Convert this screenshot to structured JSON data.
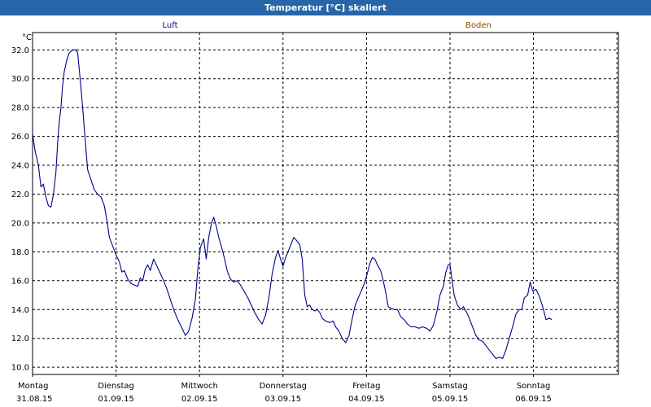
{
  "title": "Temperatur [°C] skaliert",
  "colors": {
    "titlebar": "#2565a8",
    "luft": "#00008b",
    "boden": "#8b4a00",
    "grid": "#000000"
  },
  "chart_data": {
    "type": "line",
    "title": "Temperatur [°C] skaliert",
    "ylabel": "°C",
    "ylim": [
      9.5,
      33.2
    ],
    "yticks": [
      "10.0",
      "12.0",
      "14.0",
      "16.0",
      "18.0",
      "20.0",
      "22.0",
      "24.0",
      "26.0",
      "28.0",
      "30.0",
      "32.0"
    ],
    "xlim": [
      0,
      7
    ],
    "xticks": [
      {
        "day": "Montag",
        "date": "31.08.15"
      },
      {
        "day": "Dienstag",
        "date": "01.09.15"
      },
      {
        "day": "Mittwoch",
        "date": "02.09.15"
      },
      {
        "day": "Donnerstag",
        "date": "03.09.15"
      },
      {
        "day": "Freitag",
        "date": "04.09.15"
      },
      {
        "day": "Samstag",
        "date": "05.09.15"
      },
      {
        "day": "Sonntag",
        "date": "06.09.15"
      }
    ],
    "grid": true,
    "legend_position": "top",
    "series": [
      {
        "name": "Luft",
        "color": "#00008b",
        "points": [
          [
            0.0,
            26.2
          ],
          [
            0.03,
            25.0
          ],
          [
            0.07,
            24.0
          ],
          [
            0.1,
            22.5
          ],
          [
            0.13,
            22.7
          ],
          [
            0.16,
            21.8
          ],
          [
            0.19,
            21.2
          ],
          [
            0.22,
            21.1
          ],
          [
            0.25,
            22.0
          ],
          [
            0.28,
            23.5
          ],
          [
            0.3,
            25.5
          ],
          [
            0.32,
            27.0
          ],
          [
            0.34,
            28.0
          ],
          [
            0.36,
            29.5
          ],
          [
            0.38,
            30.5
          ],
          [
            0.41,
            31.3
          ],
          [
            0.44,
            31.8
          ],
          [
            0.48,
            32.0
          ],
          [
            0.52,
            32.0
          ],
          [
            0.54,
            31.8
          ],
          [
            0.57,
            30.0
          ],
          [
            0.6,
            28.0
          ],
          [
            0.63,
            25.8
          ],
          [
            0.66,
            23.7
          ],
          [
            0.7,
            23.0
          ],
          [
            0.74,
            22.3
          ],
          [
            0.78,
            22.0
          ],
          [
            0.82,
            21.8
          ],
          [
            0.86,
            21.2
          ],
          [
            0.89,
            20.2
          ],
          [
            0.92,
            19.0
          ],
          [
            0.96,
            18.4
          ],
          [
            1.0,
            17.8
          ],
          [
            1.04,
            17.3
          ],
          [
            1.07,
            16.6
          ],
          [
            1.1,
            16.7
          ],
          [
            1.14,
            16.1
          ],
          [
            1.18,
            15.8
          ],
          [
            1.22,
            15.7
          ],
          [
            1.26,
            15.6
          ],
          [
            1.29,
            16.2
          ],
          [
            1.32,
            16.0
          ],
          [
            1.35,
            16.8
          ],
          [
            1.38,
            17.1
          ],
          [
            1.41,
            16.7
          ],
          [
            1.45,
            17.5
          ],
          [
            1.49,
            17.0
          ],
          [
            1.53,
            16.5
          ],
          [
            1.57,
            16.0
          ],
          [
            1.61,
            15.4
          ],
          [
            1.65,
            14.7
          ],
          [
            1.69,
            14.0
          ],
          [
            1.74,
            13.3
          ],
          [
            1.79,
            12.7
          ],
          [
            1.83,
            12.2
          ],
          [
            1.87,
            12.5
          ],
          [
            1.91,
            13.4
          ],
          [
            1.95,
            14.7
          ],
          [
            1.98,
            16.8
          ],
          [
            2.01,
            18.3
          ],
          [
            2.05,
            18.9
          ],
          [
            2.08,
            17.5
          ],
          [
            2.11,
            19.0
          ],
          [
            2.14,
            19.9
          ],
          [
            2.17,
            20.4
          ],
          [
            2.2,
            19.8
          ],
          [
            2.23,
            19.0
          ],
          [
            2.27,
            18.2
          ],
          [
            2.3,
            17.5
          ],
          [
            2.33,
            16.7
          ],
          [
            2.37,
            16.1
          ],
          [
            2.41,
            15.9
          ],
          [
            2.45,
            16.0
          ],
          [
            2.49,
            15.7
          ],
          [
            2.53,
            15.3
          ],
          [
            2.58,
            14.8
          ],
          [
            2.62,
            14.3
          ],
          [
            2.66,
            13.8
          ],
          [
            2.71,
            13.3
          ],
          [
            2.75,
            13.0
          ],
          [
            2.79,
            13.6
          ],
          [
            2.83,
            14.8
          ],
          [
            2.87,
            16.5
          ],
          [
            2.91,
            17.6
          ],
          [
            2.94,
            18.1
          ],
          [
            2.97,
            17.5
          ],
          [
            3.0,
            17.0
          ],
          [
            3.03,
            17.6
          ],
          [
            3.06,
            18.0
          ],
          [
            3.1,
            18.6
          ],
          [
            3.13,
            19.0
          ],
          [
            3.16,
            18.8
          ],
          [
            3.2,
            18.5
          ],
          [
            3.23,
            17.5
          ],
          [
            3.26,
            15.0
          ],
          [
            3.29,
            14.2
          ],
          [
            3.32,
            14.3
          ],
          [
            3.35,
            14.0
          ],
          [
            3.38,
            13.9
          ],
          [
            3.41,
            14.0
          ],
          [
            3.44,
            13.8
          ],
          [
            3.47,
            13.4
          ],
          [
            3.51,
            13.2
          ],
          [
            3.56,
            13.1
          ],
          [
            3.6,
            13.2
          ],
          [
            3.63,
            12.8
          ],
          [
            3.67,
            12.5
          ],
          [
            3.71,
            12.0
          ],
          [
            3.75,
            11.7
          ],
          [
            3.79,
            12.2
          ],
          [
            3.82,
            13.1
          ],
          [
            3.86,
            14.2
          ],
          [
            3.9,
            14.8
          ],
          [
            3.94,
            15.3
          ],
          [
            3.98,
            15.9
          ],
          [
            4.01,
            16.5
          ],
          [
            4.04,
            17.2
          ],
          [
            4.07,
            17.6
          ],
          [
            4.1,
            17.5
          ],
          [
            4.13,
            17.1
          ],
          [
            4.17,
            16.7
          ],
          [
            4.2,
            16.0
          ],
          [
            4.23,
            15.2
          ],
          [
            4.26,
            14.2
          ],
          [
            4.29,
            14.1
          ],
          [
            4.33,
            14.0
          ],
          [
            4.37,
            14.0
          ],
          [
            4.41,
            13.5
          ],
          [
            4.45,
            13.3
          ],
          [
            4.49,
            13.0
          ],
          [
            4.53,
            12.8
          ],
          [
            4.58,
            12.8
          ],
          [
            4.63,
            12.7
          ],
          [
            4.67,
            12.8
          ],
          [
            4.72,
            12.7
          ],
          [
            4.76,
            12.5
          ],
          [
            4.8,
            12.9
          ],
          [
            4.84,
            13.8
          ],
          [
            4.88,
            15.0
          ],
          [
            4.92,
            15.6
          ],
          [
            4.95,
            16.6
          ],
          [
            4.98,
            17.1
          ],
          [
            5.0,
            17.1
          ],
          [
            5.02,
            16.2
          ],
          [
            5.05,
            15.0
          ],
          [
            5.09,
            14.3
          ],
          [
            5.13,
            14.0
          ],
          [
            5.16,
            14.2
          ],
          [
            5.2,
            13.8
          ],
          [
            5.23,
            13.4
          ],
          [
            5.27,
            12.8
          ],
          [
            5.31,
            12.2
          ],
          [
            5.35,
            11.9
          ],
          [
            5.39,
            11.8
          ],
          [
            5.43,
            11.5
          ],
          [
            5.47,
            11.2
          ],
          [
            5.51,
            10.9
          ],
          [
            5.55,
            10.6
          ],
          [
            5.59,
            10.7
          ],
          [
            5.63,
            10.6
          ],
          [
            5.67,
            11.2
          ],
          [
            5.71,
            12.0
          ],
          [
            5.75,
            12.8
          ],
          [
            5.79,
            13.7
          ],
          [
            5.83,
            14.0
          ],
          [
            5.86,
            14.0
          ],
          [
            5.89,
            14.8
          ],
          [
            5.93,
            15.0
          ],
          [
            5.96,
            15.9
          ],
          [
            5.99,
            15.3
          ],
          [
            6.03,
            15.4
          ],
          [
            6.07,
            14.9
          ],
          [
            6.11,
            14.2
          ],
          [
            6.15,
            13.3
          ],
          [
            6.19,
            13.4
          ],
          [
            6.22,
            13.3
          ]
        ]
      },
      {
        "name": "Boden",
        "color": "#8b4a00",
        "points": []
      }
    ]
  }
}
